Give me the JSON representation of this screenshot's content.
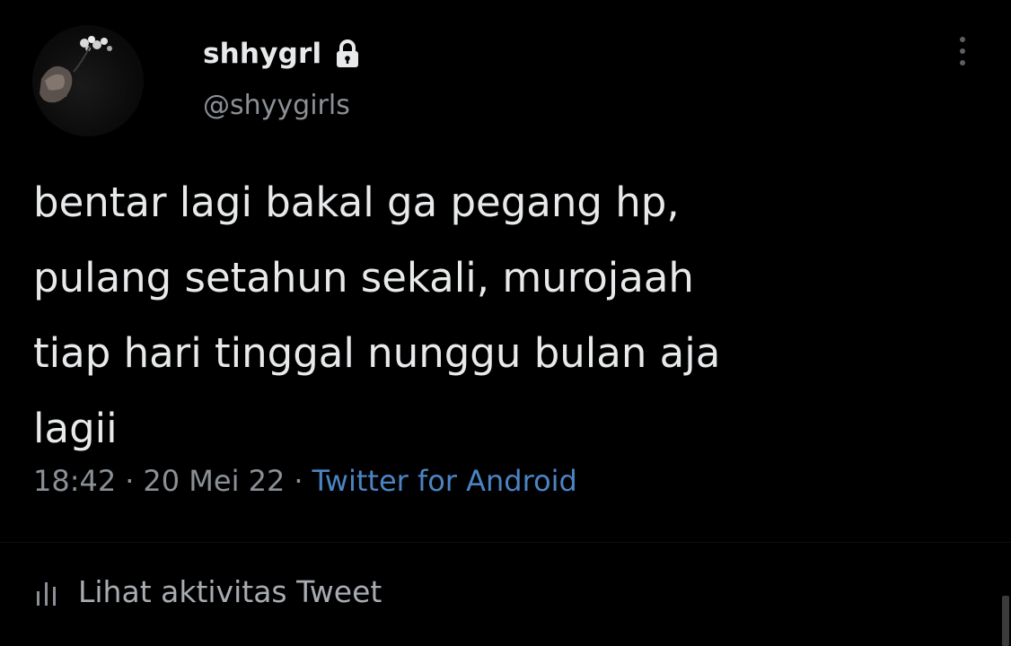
{
  "tweet": {
    "display_name": "shhygrl",
    "handle": "@shyygirls",
    "text_lines": [
      "bentar lagi bakal ga pegang hp,",
      "pulang setahun sekali, murojaah",
      "tiap hari tinggal nunggu bulan aja",
      "lagii"
    ],
    "time": "18:42",
    "separator": "·",
    "date": "20 Mei 22",
    "source": "Twitter for Android",
    "activity_label": "Lihat aktivitas Tweet"
  },
  "icons": {
    "lock": "lock-icon",
    "more": "more-vertical-icon",
    "activity": "bar-chart-icon"
  },
  "colors": {
    "background": "#000000",
    "text": "#e7e9ea",
    "muted": "#8b9096",
    "link": "#4b84c4"
  }
}
